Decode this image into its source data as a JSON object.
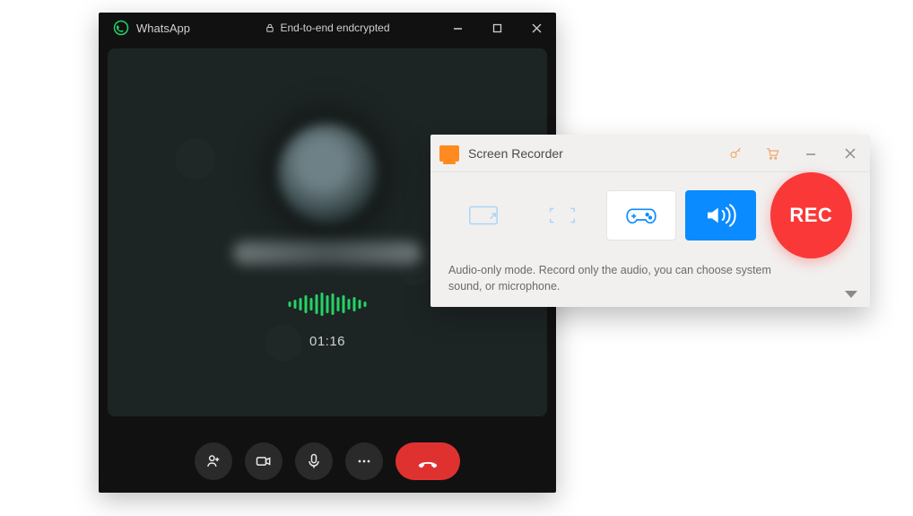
{
  "whatsapp": {
    "app_name": "WhatsApp",
    "encryption_label": "End-to-end endcrypted",
    "call_timer": "01:16",
    "buttons": {
      "add_participant": "add-participant",
      "video": "video",
      "mic": "microphone",
      "more": "more",
      "hangup": "hang-up"
    }
  },
  "recorder": {
    "title": "Screen Recorder",
    "rec_label": "REC",
    "description": "Audio-only mode. Record only the audio, you can choose system sound, or microphone.",
    "modes": {
      "region": "region",
      "fullscreen": "fullscreen",
      "game": "game",
      "audio": "audio"
    }
  }
}
